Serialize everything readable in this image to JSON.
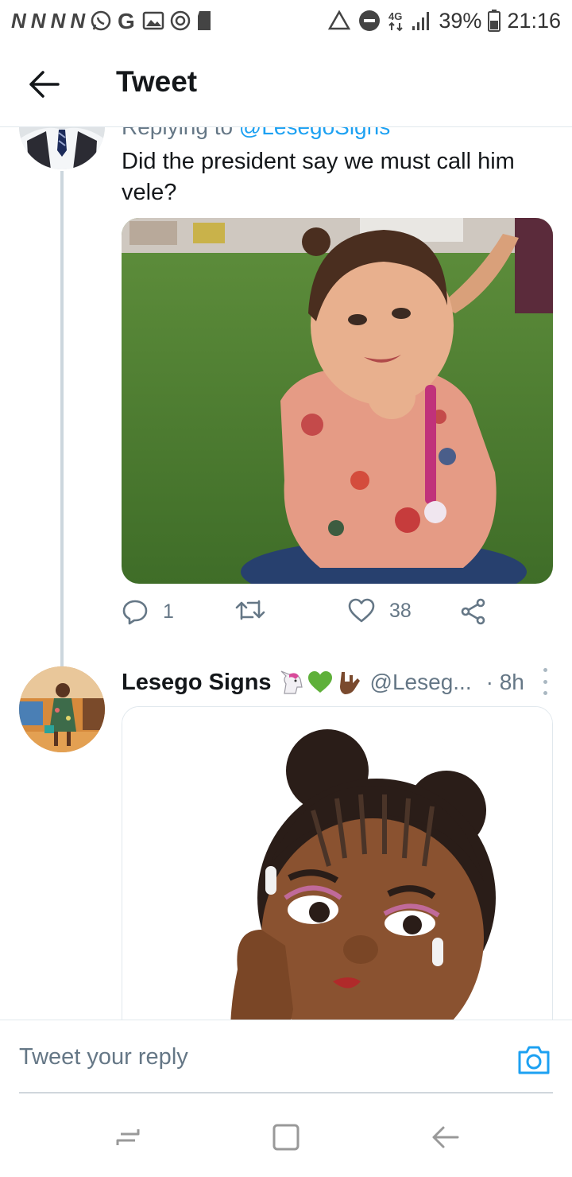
{
  "status_bar": {
    "left_letters": [
      "N",
      "N",
      "N",
      "N"
    ],
    "left_icons": [
      "whatsapp-icon",
      "google-icon",
      "image-icon",
      "data-saver-icon",
      "sd-card-icon"
    ],
    "right_icons": [
      "recycle-icon",
      "dnd-icon",
      "network-4g-icon",
      "signal-icon"
    ],
    "network": "4G",
    "battery": "39%",
    "time": "21:16"
  },
  "header": {
    "title": "Tweet",
    "back_icon": "arrow-left-icon"
  },
  "reply_tweet": {
    "replying_prefix": "Replying to",
    "replying_handle": "@LesegoSigns",
    "text": "Did the president say we must call him vele?",
    "media_description_icon": "photo-icon",
    "actions": {
      "reply_count": "1",
      "retweet_count": "",
      "like_count": "38"
    }
  },
  "second_tweet": {
    "name": "Lesego Signs",
    "emojis": [
      "unicorn-emoji",
      "green-heart-emoji",
      "rock-on-hand-emoji"
    ],
    "handle": "@Leseg...",
    "time": "· 8h"
  },
  "reply_bar": {
    "placeholder": "Tweet your reply",
    "camera_icon": "camera-icon"
  },
  "navbar": {
    "icons": [
      "recent-apps-icon",
      "home-icon",
      "back-icon"
    ]
  },
  "colors": {
    "accent": "#1da1f2",
    "text_secondary": "#657786",
    "thread_line": "#ccd6dd"
  }
}
